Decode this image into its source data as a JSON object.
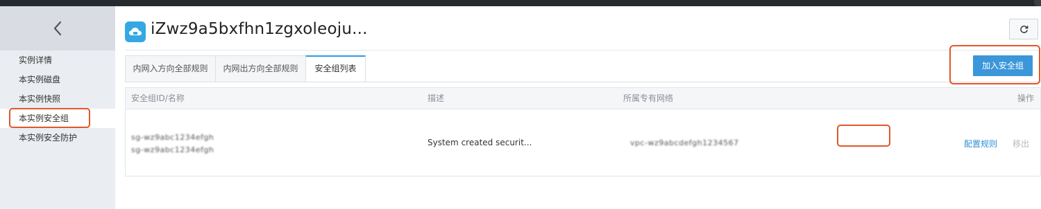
{
  "instance": {
    "title": "iZwz9a5bxfhn1zgxoleoju..."
  },
  "sidebar": {
    "items": [
      {
        "label": "实例详情"
      },
      {
        "label": "本实例磁盘"
      },
      {
        "label": "本实例快照"
      },
      {
        "label": "本实例安全组"
      },
      {
        "label": "本实例安全防护"
      }
    ],
    "active_index": 3
  },
  "tabs": [
    {
      "label": "内网入方向全部规则"
    },
    {
      "label": "内网出方向全部规则"
    },
    {
      "label": "安全组列表"
    }
  ],
  "active_tab": 2,
  "toolbar": {
    "add_label": "加入安全组"
  },
  "table": {
    "headers": [
      "安全组ID/名称",
      "描述",
      "所属专有网络",
      "操作"
    ],
    "rows": [
      {
        "id_line1": "sg-wz9abc1234efgh",
        "id_line2": "sg-wz9abc1234efgh",
        "description": "System created securit...",
        "vpc": "vpc-wz9abcdefgh1234567",
        "action_config": "配置规则",
        "action_remove": "移出"
      }
    ]
  },
  "colors": {
    "accent": "#3b97d9",
    "highlight": "#e0572a",
    "sidebar_bg": "#eaedf1",
    "topbar": "#252a2f"
  },
  "icons": {
    "back": "chevron-left-icon",
    "instance": "cloud-server-icon",
    "refresh": "refresh-icon"
  }
}
